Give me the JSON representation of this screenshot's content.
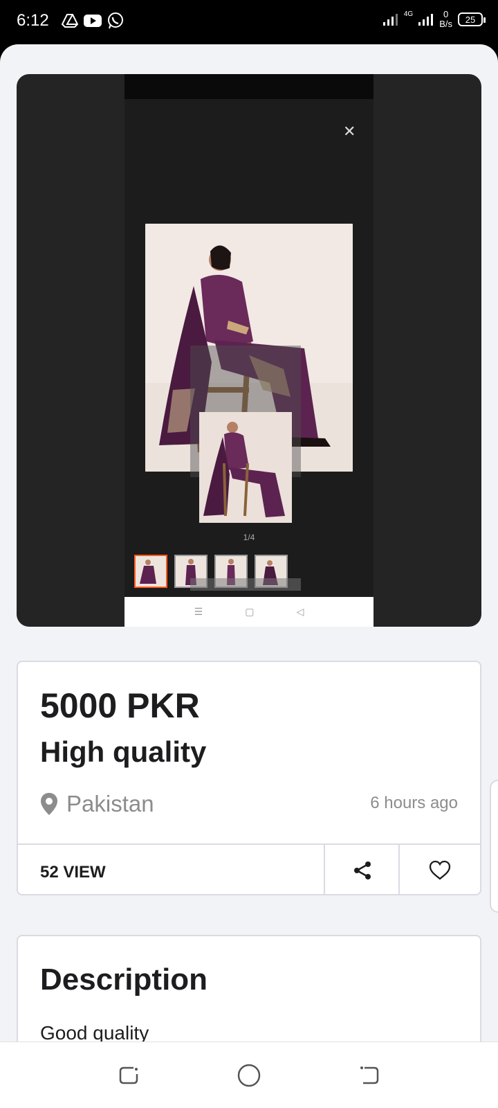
{
  "status_bar": {
    "time": "6:12",
    "network": "4G",
    "speed_value": "0",
    "speed_unit": "B/s",
    "battery": "25"
  },
  "media": {
    "counter": "1/4",
    "close_icon": "close-icon",
    "thumbnail_count": 4,
    "active_thumbnail": 1
  },
  "listing": {
    "price": "5000 PKR",
    "title": "High quality",
    "location": "Pakistan",
    "posted": "6 hours ago",
    "views": "52 VIEW"
  },
  "description": {
    "heading": "Description",
    "text": "Good quality"
  },
  "colors": {
    "accent": "#ff5a1f",
    "background": "#f2f3f7",
    "muted_text": "#8c8c8c"
  }
}
